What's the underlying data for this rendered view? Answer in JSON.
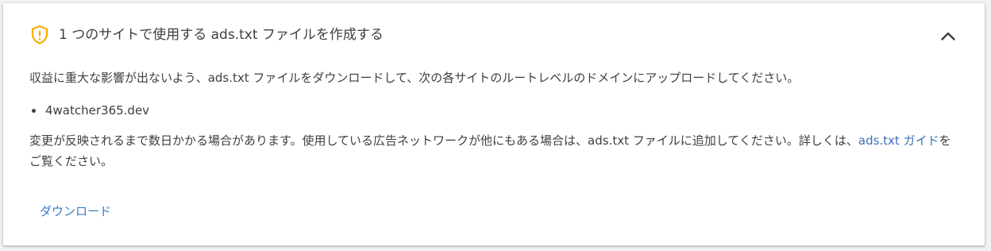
{
  "header": {
    "title": "1 つのサイトで使用する ads.txt ファイルを作成する",
    "warning_icon": "warning-shield-icon",
    "collapse_icon": "chevron-up-icon"
  },
  "body": {
    "intro": "収益に重大な影響が出ないよう、ads.txt ファイルをダウンロードして、次の各サイトのルートレベルのドメインにアップロードしてください。",
    "sites": [
      "4watcher365.dev"
    ],
    "note_before_link": "変更が反映されるまで数日かかる場合があります。使用している広告ネットワークが他にもある場合は、ads.txt ファイルに追加してください。詳しくは、",
    "note_link": "ads.txt ガイド",
    "note_after_link": "をご覧ください。"
  },
  "actions": {
    "download_label": "ダウンロード"
  },
  "colors": {
    "warning": "#f9ab00",
    "link": "#3c6fb8",
    "button_text": "#3a7bc8"
  }
}
